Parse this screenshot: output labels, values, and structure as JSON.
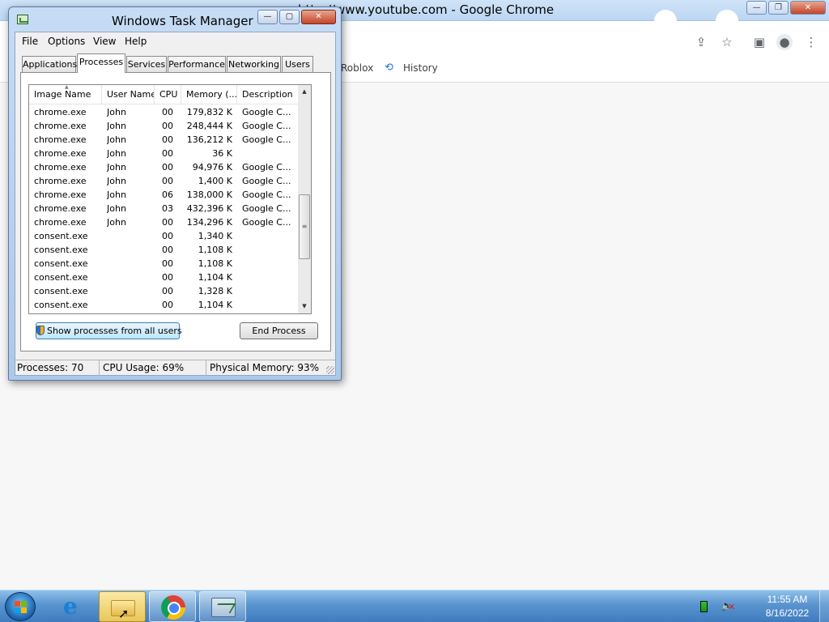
{
  "chrome": {
    "window_title": "http://www.youtube.com - Google Chrome",
    "bookmarks": [
      {
        "label": "Roblox"
      },
      {
        "label": "History"
      }
    ],
    "controls": {
      "minimize": "—",
      "maximize": "❐",
      "close": "✕"
    }
  },
  "task_manager": {
    "title": "Windows Task Manager",
    "window_controls": {
      "minimize": "—",
      "maximize": "▢",
      "close": "✕"
    },
    "menu": [
      "File",
      "Options",
      "View",
      "Help"
    ],
    "tabs": [
      "Applications",
      "Processes",
      "Services",
      "Performance",
      "Networking",
      "Users"
    ],
    "active_tab": "Processes",
    "columns": [
      "Image Name",
      "User Name",
      "CPU",
      "Memory (...",
      "Description"
    ],
    "processes": [
      {
        "name": "chrome.exe",
        "user": "John",
        "cpu": "00",
        "memory": "179,832 K",
        "description": "Google C..."
      },
      {
        "name": "chrome.exe",
        "user": "John",
        "cpu": "00",
        "memory": "248,444 K",
        "description": "Google C..."
      },
      {
        "name": "chrome.exe",
        "user": "John",
        "cpu": "00",
        "memory": "136,212 K",
        "description": "Google C..."
      },
      {
        "name": "chrome.exe",
        "user": "John",
        "cpu": "00",
        "memory": "36 K",
        "description": ""
      },
      {
        "name": "chrome.exe",
        "user": "John",
        "cpu": "00",
        "memory": "94,976 K",
        "description": "Google C..."
      },
      {
        "name": "chrome.exe",
        "user": "John",
        "cpu": "00",
        "memory": "1,400 K",
        "description": "Google C..."
      },
      {
        "name": "chrome.exe",
        "user": "John",
        "cpu": "06",
        "memory": "138,000 K",
        "description": "Google C..."
      },
      {
        "name": "chrome.exe",
        "user": "John",
        "cpu": "03",
        "memory": "432,396 K",
        "description": "Google C..."
      },
      {
        "name": "chrome.exe",
        "user": "John",
        "cpu": "00",
        "memory": "134,296 K",
        "description": "Google C..."
      },
      {
        "name": "consent.exe",
        "user": "",
        "cpu": "00",
        "memory": "1,340 K",
        "description": ""
      },
      {
        "name": "consent.exe",
        "user": "",
        "cpu": "00",
        "memory": "1,108 K",
        "description": ""
      },
      {
        "name": "consent.exe",
        "user": "",
        "cpu": "00",
        "memory": "1,108 K",
        "description": ""
      },
      {
        "name": "consent.exe",
        "user": "",
        "cpu": "00",
        "memory": "1,104 K",
        "description": ""
      },
      {
        "name": "consent.exe",
        "user": "",
        "cpu": "00",
        "memory": "1,328 K",
        "description": ""
      },
      {
        "name": "consent.exe",
        "user": "",
        "cpu": "00",
        "memory": "1,104 K",
        "description": ""
      }
    ],
    "buttons": {
      "show_all": "Show processes from all users",
      "end_process": "End Process"
    },
    "status": {
      "processes": "Processes: 70",
      "cpu_usage": "CPU Usage: 69%",
      "physical_memory": "Physical Memory: 93%"
    }
  },
  "taskbar": {
    "clock_time": "11:55 AM",
    "clock_date": "8/16/2022",
    "items": [
      "windows-start",
      "internet-explorer",
      "windows-explorer",
      "google-chrome",
      "task-manager"
    ]
  },
  "colors": {
    "taskbar": "#4f8ac9",
    "selection_button": "#bee6fd",
    "close_button": "#c3452a",
    "chrome_icon_blue": "#4285f4"
  }
}
